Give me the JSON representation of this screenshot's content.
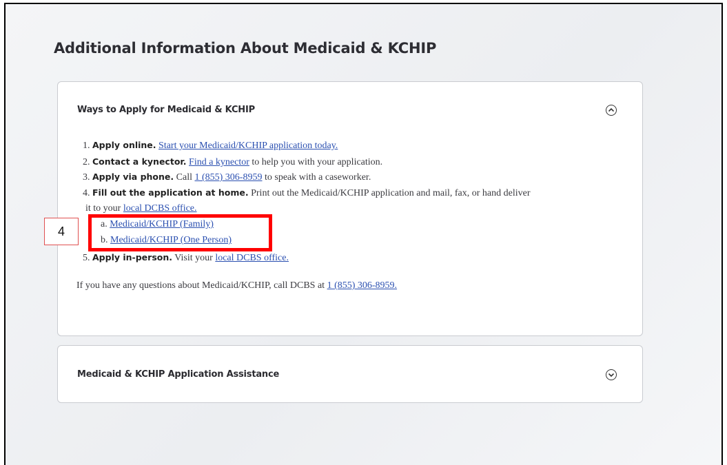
{
  "page": {
    "title": "Additional Information About Medicaid & KCHIP"
  },
  "panels": [
    {
      "header": "Ways to Apply for Medicaid & KCHIP",
      "expanded": true,
      "icon": "chevron-up-circle-icon",
      "items": [
        {
          "num": "1.",
          "bold": "Apply online.",
          "link": "Start your Medicaid/KCHIP application today."
        },
        {
          "num": "2.",
          "bold": "Contact a kynector.",
          "link": "Find a kynector",
          "after": "to help you with your application."
        },
        {
          "num": "3.",
          "bold": "Apply via phone.",
          "before": "Call",
          "link": "1 (855) 306-8959",
          "after": "to speak with a caseworker."
        },
        {
          "num": "4.",
          "bold": "Fill out the application at home.",
          "text": "Print out the Medicaid/KCHIP application and mail, fax, or hand deliver",
          "text2": "it to your",
          "link": "local DCBS office."
        },
        {
          "num": "5.",
          "bold": "Apply in-person.",
          "before": "Visit your",
          "link": "local DCBS office."
        }
      ],
      "subitems": [
        {
          "letter": "a.",
          "link": "Medicaid/KCHIP (Family)"
        },
        {
          "letter": "b.",
          "link": "Medicaid/KCHIP (One Person)"
        }
      ],
      "footer": {
        "text": "If you have any questions about Medicaid/KCHIP, call DCBS at",
        "link": "1 (855) 306-8959."
      }
    },
    {
      "header": "Medicaid & KCHIP Application Assistance",
      "expanded": false,
      "icon": "chevron-down-circle-icon"
    }
  ],
  "annotation": {
    "label": "4",
    "color": "#ff0000"
  }
}
